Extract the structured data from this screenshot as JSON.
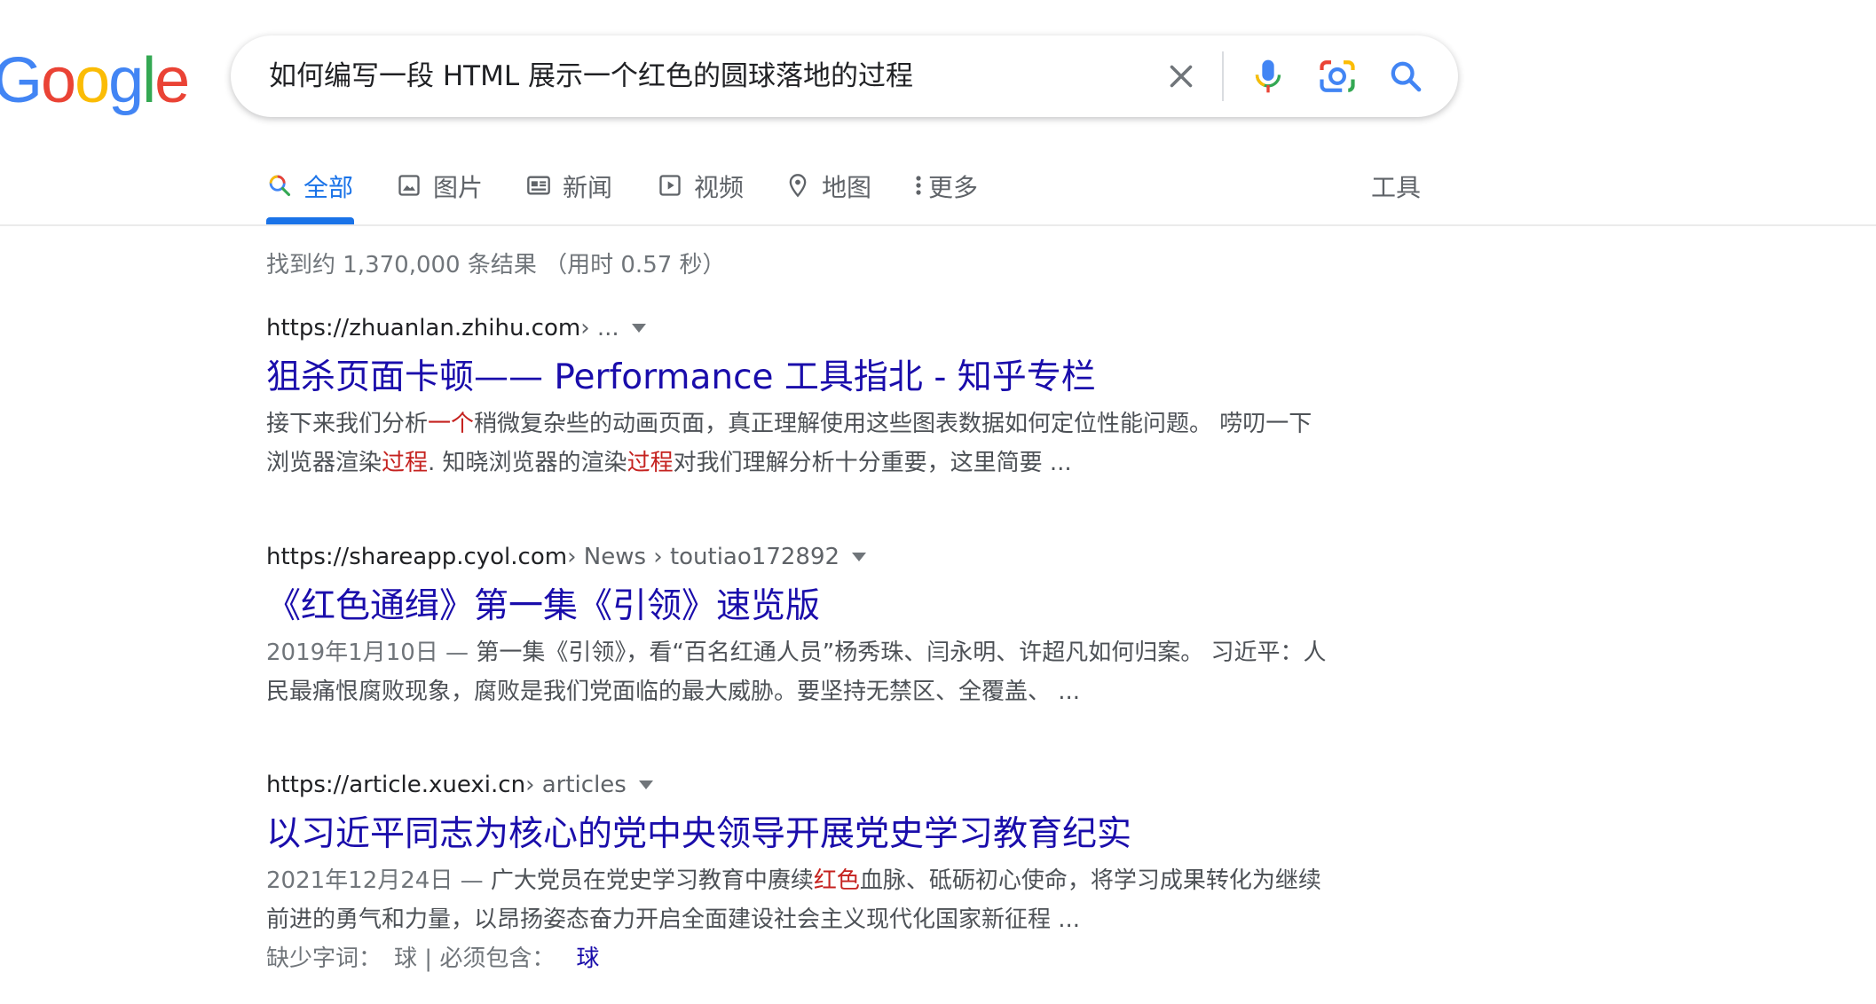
{
  "logo": {
    "letters": [
      "G",
      "o",
      "o",
      "g",
      "l",
      "e"
    ],
    "colors": [
      "#4285F4",
      "#EA4335",
      "#FBBC05",
      "#4285F4",
      "#34A853",
      "#EA4335"
    ]
  },
  "search": {
    "query": "如何编写一段 HTML 展示一个红色的圆球落地的过程",
    "icons": [
      "close-icon",
      "mic-icon",
      "camera-lens-icon",
      "search-icon"
    ]
  },
  "tabs": [
    {
      "label": "全部",
      "icon": "search-icon",
      "active": true
    },
    {
      "label": "图片",
      "icon": "image-icon",
      "active": false
    },
    {
      "label": "新闻",
      "icon": "news-icon",
      "active": false
    },
    {
      "label": "视频",
      "icon": "video-icon",
      "active": false
    },
    {
      "label": "地图",
      "icon": "map-pin-icon",
      "active": false
    },
    {
      "label": "更多",
      "icon": "more-vert-icon",
      "active": false
    }
  ],
  "tools_label": "工具",
  "stats": "找到约 1,370,000 条结果 （用时 0.57 秒）",
  "results": [
    {
      "url": "https://zhuanlan.zhihu.com",
      "crumbs": " › ...",
      "title": "狙杀页面卡顿—— Performance 工具指北 - 知乎专栏",
      "date": "",
      "snippet": [
        {
          "t": "接下来我们分析",
          "hl": false
        },
        {
          "t": "一个",
          "hl": true
        },
        {
          "t": "稍微复杂些的动画页面，真正理解使用这些图表数据如何定位性能问题。 唠叨一下浏览器渲染",
          "hl": false
        },
        {
          "t": "过程",
          "hl": true
        },
        {
          "t": ". 知晓浏览器的渲染",
          "hl": false
        },
        {
          "t": "过程",
          "hl": true
        },
        {
          "t": "对我们理解分析十分重要，这里简要 ...",
          "hl": false
        }
      ]
    },
    {
      "url": "https://shareapp.cyol.com",
      "crumbs": " › News › toutiao172892",
      "title": "《红色通缉》第一集《引领》速览版",
      "date": "2019年1月10日 — ",
      "snippet": [
        {
          "t": "第一集《引领》，看“百名红通人员”杨秀珠、闫永明、许超凡如何归案。 习近平：人民最痛恨腐败现象，腐败是我们党面临的最大威胁。要坚持无禁区、全覆盖、 ...",
          "hl": false
        }
      ]
    },
    {
      "url": "https://article.xuexi.cn",
      "crumbs": " › articles",
      "title": "以习近平同志为核心的党中央领导开展党史学习教育纪实",
      "date": "2021年12月24日 — ",
      "snippet": [
        {
          "t": "广大党员在党史学习教育中赓续",
          "hl": false
        },
        {
          "t": "红色",
          "hl": true
        },
        {
          "t": "血脉、砥砺初心使命，将学习成果转化为继续前进的勇气和力量，以昂扬姿态奋力开启全面建设社会主义现代化国家新征程 ...",
          "hl": false
        }
      ],
      "missing": {
        "label": "缺少字词：",
        "word": "球",
        "must_label": " | 必须包含：",
        "must_word": "球"
      }
    }
  ]
}
